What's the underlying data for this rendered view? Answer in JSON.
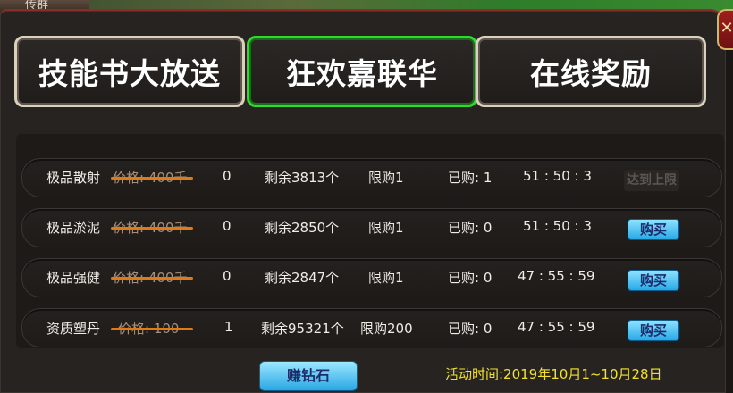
{
  "top": {
    "left_text": "传群",
    "close_icon": "close-icon"
  },
  "tabs": [
    {
      "label": "技能书大放送",
      "active": false
    },
    {
      "label": "狂欢嘉联华",
      "active": true
    },
    {
      "label": "在线奖励",
      "active": false
    }
  ],
  "rows": [
    {
      "name": "极品散射",
      "price": "价格: 400千",
      "now": "0",
      "remain": "剩余3813个",
      "limit": "限购1",
      "bought": "已购: 1",
      "timer": "51 : 50 : 3",
      "action": "达到上限",
      "action_enabled": false
    },
    {
      "name": "极品淤泥",
      "price": "价格: 400千",
      "now": "0",
      "remain": "剩余2850个",
      "limit": "限购1",
      "bought": "已购: 0",
      "timer": "51 : 50 : 3",
      "action": "购买",
      "action_enabled": true
    },
    {
      "name": "极品强健",
      "price": "价格: 400千",
      "now": "0",
      "remain": "剩余2847个",
      "limit": "限购1",
      "bought": "已购: 0",
      "timer": "47 : 55 : 59",
      "action": "购买",
      "action_enabled": true
    },
    {
      "name": "资质塑丹",
      "price": "价格: 100",
      "now": "1",
      "remain": "剩余95321个",
      "limit": "限购200",
      "bought": "已购: 0",
      "timer": "47 : 55 : 59",
      "action": "购买",
      "action_enabled": true
    }
  ],
  "footer": {
    "earn_label": "赚钻石",
    "activity_time": "活动时间:2019年10月1~10月28日"
  },
  "colors": {
    "active_tab": "#2ddb2d",
    "strike": "#e07a16",
    "activity_text": "#f2e22c",
    "buy_button": "#27a8e6"
  }
}
